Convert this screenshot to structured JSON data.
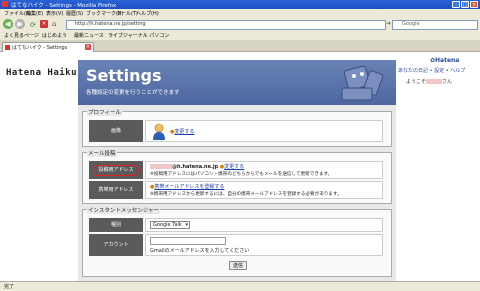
{
  "window": {
    "title": "はてなハイク - Settings - Mozilla Firefox"
  },
  "menu": [
    "ファイル(F)",
    "編集(E)",
    "表示(V)",
    "履歴(S)",
    "ブックマーク(B)",
    "ツール(T)",
    "ヘルプ(H)"
  ],
  "nav": {
    "url": "http://h.hatena.ne.jp/setting",
    "search_placeholder": "Google"
  },
  "bookmarks": [
    "よく見るページ",
    "はじめよう",
    "最新ニュース",
    "ライブジャーナル パソコン"
  ],
  "tab": {
    "label": "はてなハイク - Settings"
  },
  "logo": "Hatena Haiku",
  "hatena_mark": "✿Hatena",
  "right_links": "あなたの日記 • 設定 • ヘルプ",
  "right_user_suffix": "さん",
  "right_user_prefix": "ようこそ",
  "header": {
    "title": "Settings",
    "subtitle": "各種設定の変更を行うことができます"
  },
  "profile": {
    "legend": "プロフィール",
    "image_label": "画像",
    "change_link": "変更する"
  },
  "mail": {
    "legend": "メール投稿",
    "post_addr_label": "投稿用アドレス",
    "addr_domain": "@h.hatena.ne.jp",
    "addr_change": "変更する",
    "addr_note": "※投稿用アドレスにはパソコン・携帯のどちらからでもメールを送信して更新できます。",
    "mobile_label": "携帯用アドレス",
    "mobile_link": "携帯メールアドレスを登録する",
    "mobile_note": "※携帯用アドレスから更新するには、自分の携帯メールアドレスを登録する必要があります。"
  },
  "im": {
    "legend": "インスタントメッセンジャー",
    "type_label": "種別",
    "type_value": "Google Talk",
    "account_label": "アカウント",
    "account_note": "Gmailのメールアドレスを入力してください",
    "submit": "送信"
  },
  "status": "完了"
}
